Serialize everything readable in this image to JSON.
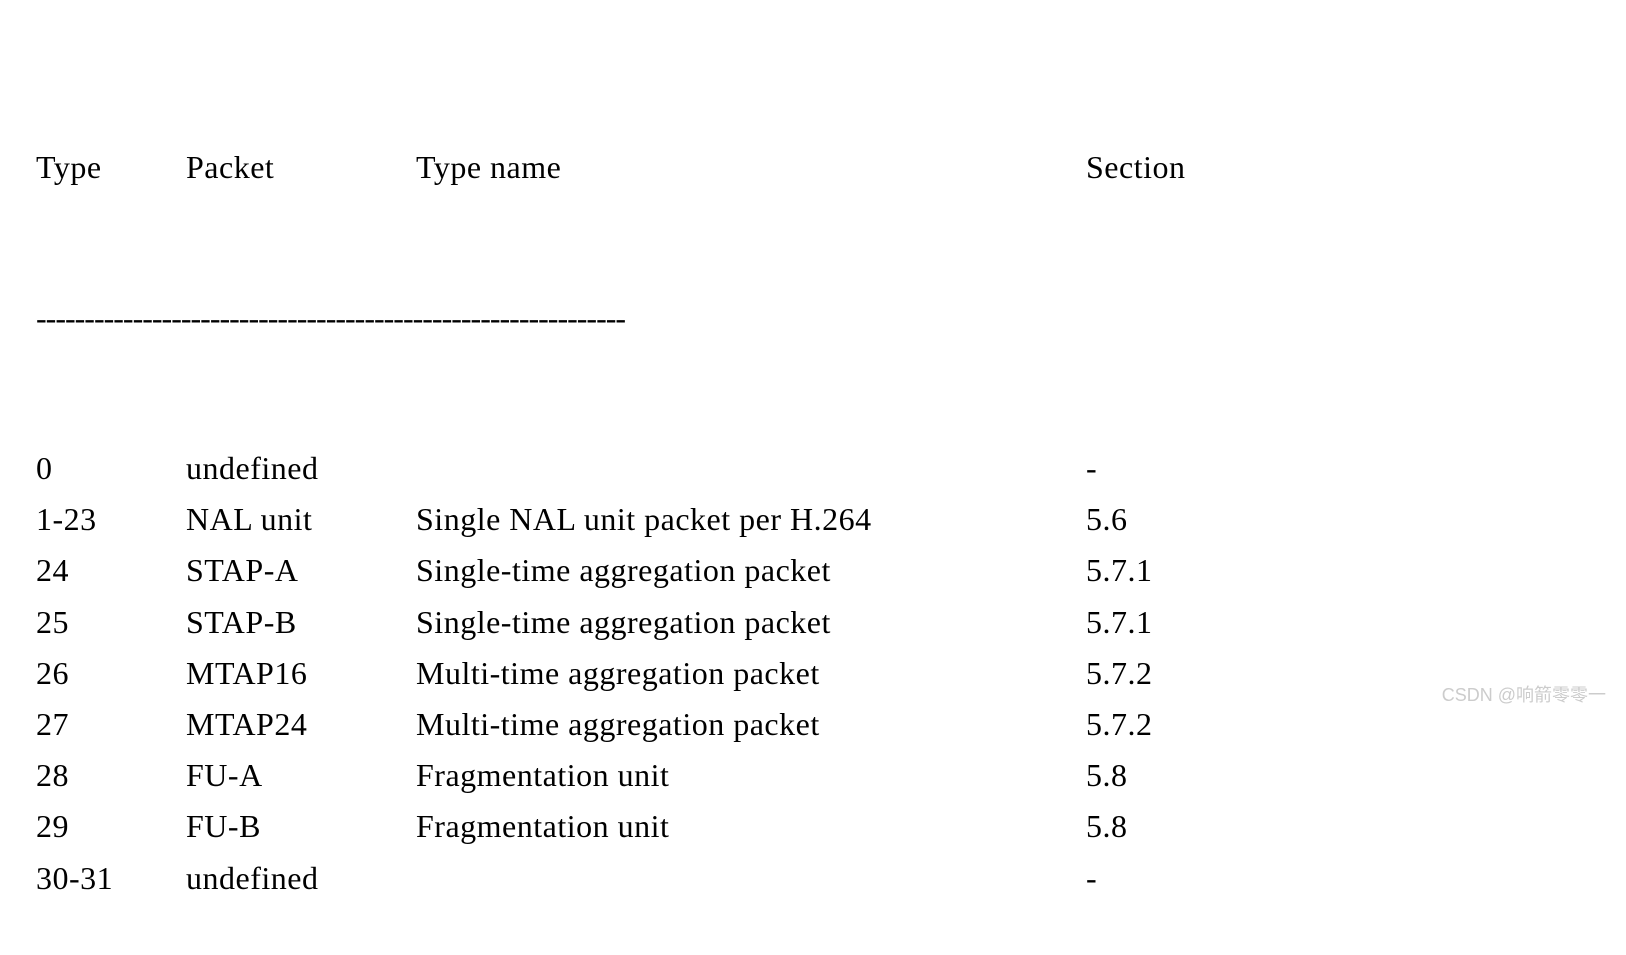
{
  "headers": {
    "type": "Type",
    "packet": "Packet",
    "typename": "Type name",
    "section": "Section"
  },
  "separator": "-------------------------------------------------------------",
  "rows": [
    {
      "type": "0",
      "packet": "undefined",
      "typename": "",
      "section": "-"
    },
    {
      "type": "1-23",
      "packet": "NAL unit",
      "typename": "Single NAL unit packet per H.264",
      "section": "5.6"
    },
    {
      "type": "24",
      "packet": "STAP-A",
      "typename": "Single-time aggregation packet",
      "section": "5.7.1"
    },
    {
      "type": "25",
      "packet": "STAP-B",
      "typename": "Single-time aggregation packet",
      "section": "5.7.1"
    },
    {
      "type": "26",
      "packet": "MTAP16",
      "typename": "Multi-time aggregation packet",
      "section": "5.7.2"
    },
    {
      "type": "27",
      "packet": "MTAP24",
      "typename": "Multi-time aggregation packet",
      "section": "5.7.2"
    },
    {
      "type": "28",
      "packet": "FU-A",
      "typename": "Fragmentation unit",
      "section": "5.8"
    },
    {
      "type": "29",
      "packet": "FU-B",
      "typename": "Fragmentation unit",
      "section": "5.8"
    },
    {
      "type": "30-31",
      "packet": "undefined",
      "typename": "",
      "section": "-"
    }
  ],
  "watermark": "CSDN @响箭零零一"
}
